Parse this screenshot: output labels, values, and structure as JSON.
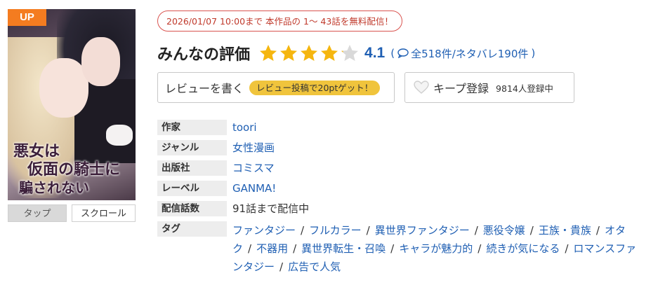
{
  "cover": {
    "badge": "UP",
    "title_lines": [
      "悪女は",
      "仮面の騎士に",
      "騙されない"
    ]
  },
  "view_modes": {
    "tap": "タップ",
    "scroll": "スクロール"
  },
  "free_notice": "2026/01/07 10:00まで 本作品の 1～ 43話を無料配信！",
  "rating": {
    "title": "みんなの評価",
    "score": "4.1",
    "score_value": 4.1,
    "stars_total": 5,
    "paren_open": "(",
    "counts": "全518件/ネタバレ190件",
    "paren_close": ")",
    "star_color": "#f5b60f",
    "star_empty_color": "#d9d9d9"
  },
  "review_button": {
    "label": "レビューを書く",
    "promo": "レビュー投稿で20ptゲット！"
  },
  "keep_button": {
    "label": "キープ登録",
    "count": "9814人登録中"
  },
  "info": {
    "author": {
      "label": "作家",
      "value": "toori"
    },
    "genre": {
      "label": "ジャンル",
      "value": "女性漫画"
    },
    "publisher": {
      "label": "出版社",
      "value": "コミスマ"
    },
    "imprint": {
      "label": "レーベル",
      "value": "GANMA!"
    },
    "episodes": {
      "label": "配信話数",
      "value": "91話まで配信中"
    },
    "tags": {
      "label": "タグ",
      "separator": "/",
      "items": [
        "ファンタジー",
        "フルカラー",
        "異世界ファンタジー",
        "悪役令嬢",
        "王族・貴族",
        "オタク",
        "不器用",
        "異世界転生・召喚",
        "キャラが魅力的",
        "続きが気になる",
        "ロマンスファンタジー",
        "広告で人気"
      ]
    }
  },
  "colors": {
    "link": "#1f5fb3",
    "badge_up": "#f47c20",
    "notice_red": "#c0392b",
    "promo_yellow": "#f0c43c"
  }
}
